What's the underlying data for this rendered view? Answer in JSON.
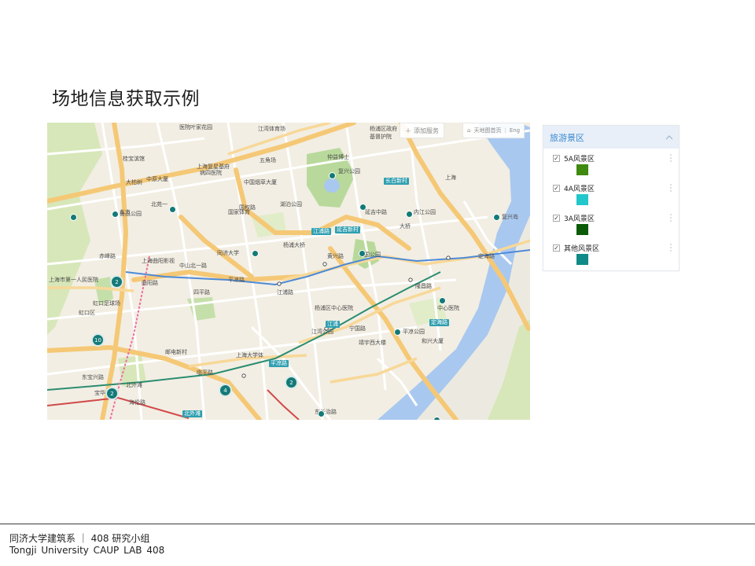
{
  "slide": {
    "title": "场地信息获取示例"
  },
  "map": {
    "toolbar": {
      "add_label": "添加服务",
      "right_label": "天地图首页",
      "right_label_2": "Eng"
    },
    "labels": [
      "医院叶家花园",
      "江湾体育场",
      "杨浦区政府",
      "基督护院",
      "桂宝滨馆",
      "中原大厦",
      "上海复星基府",
      "病四医院",
      "五角场",
      "仲益博士",
      "中国烟草大厦",
      "复兴公园",
      "湖泊公园",
      "上海曲阳影视",
      "国家体育",
      "东方",
      "北苑一",
      "四平路",
      "曲阳路",
      "平凉路",
      "杨浦大桥",
      "大桥",
      "宁国路",
      "靖宇西大楼",
      "中心医院",
      "江湾公园",
      "东长治路",
      "平凉公园",
      "和兴大厦",
      "临平路",
      "上海大学体",
      "东宝兴路",
      "宝华大楼",
      "北外滩",
      "海伦路",
      "上海市第一人民医院",
      "虹口区",
      "虹口足球场",
      "鲁迅公园",
      "邮电新村",
      "赤峰路",
      "大柏树",
      "同济大学",
      "国权路",
      "黄兴路",
      "延吉中路",
      "内江公园",
      "复兴岛",
      "隆昌路",
      "宁国公园",
      "中山北一路",
      "上海",
      "定海路",
      "江浦路",
      "杨浦区中心医院"
    ],
    "stations": [
      "长白新村",
      "延吉新村",
      "江浦路",
      "平凉路",
      "北外滩",
      "定海路",
      "江浦"
    ],
    "clusters": [
      "2",
      "2",
      "10",
      "2",
      "4",
      "2"
    ]
  },
  "legend": {
    "title": "旅游景区",
    "items": [
      {
        "label": "5A风景区",
        "color": "#3f8a0f",
        "checked": "✓"
      },
      {
        "label": "4A风景区",
        "color": "#22c7cc",
        "checked": "✓"
      },
      {
        "label": "3A风景区",
        "color": "#0a5a08",
        "checked": "✓"
      },
      {
        "label": "其他风景区",
        "color": "#108a86",
        "checked": "✓"
      }
    ]
  },
  "footer": {
    "cn": "同济大学建筑系 ｜ 408 研究小组",
    "en": "Tongji University CAUP  LAB 408"
  }
}
